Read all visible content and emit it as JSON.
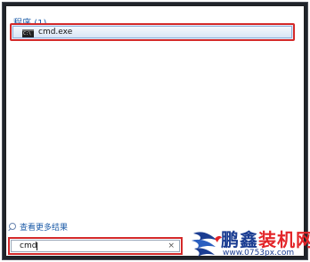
{
  "start_menu": {
    "section_title": "程序 (1)",
    "results": [
      {
        "label": "cmd.exe",
        "icon": "cmd-icon"
      }
    ],
    "see_more_label": "查看更多结果",
    "search": {
      "value": "cmd",
      "clear_glyph": "×"
    }
  },
  "watermark": {
    "brand_main": "鹏鑫",
    "brand_accent": "装机网",
    "url": "www.0753px.com",
    "colors": {
      "brand_blue": "#1b3d92",
      "brand_red": "#e32529"
    }
  },
  "colors": {
    "highlight_border": "#d42a2a",
    "link_blue": "#1d5ca8"
  }
}
